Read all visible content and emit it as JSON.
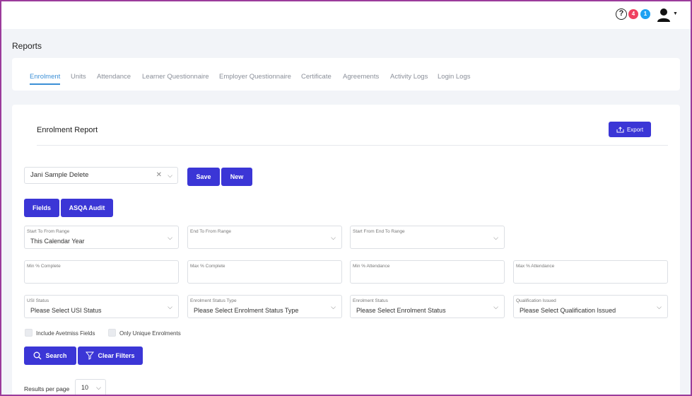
{
  "header": {
    "help_glyph": "?",
    "badges": {
      "red_count": "4",
      "blue_count": "1"
    },
    "colors": {
      "red": "#f0405f",
      "blue": "#1da1f2"
    }
  },
  "page": {
    "title": "Reports"
  },
  "tabs": [
    {
      "label": "Enrolment",
      "active": true
    },
    {
      "label": "Units"
    },
    {
      "label": "Attendance"
    },
    {
      "label": "Learner Questionnaire"
    },
    {
      "label": "Employer Questionnaire"
    },
    {
      "label": "Certificate"
    },
    {
      "label": "Agreements"
    },
    {
      "label": "Activity Logs"
    },
    {
      "label": "Login Logs"
    }
  ],
  "report": {
    "title": "Enrolment Report",
    "export_label": "Export",
    "preset": {
      "value": "Jani Sample Delete"
    },
    "save_label": "Save",
    "new_label": "New",
    "fields_label": "Fields",
    "asqa_label": "ASQA Audit"
  },
  "filters": {
    "start_to_from": {
      "label": "Start To From Range",
      "value": "This Calendar Year"
    },
    "end_to_from": {
      "label": "End To From Range",
      "value": ""
    },
    "start_from_end": {
      "label": "Start From End To Range",
      "value": ""
    },
    "min_complete": {
      "label": "Min % Complete",
      "value": ""
    },
    "max_complete": {
      "label": "Max % Complete",
      "value": ""
    },
    "min_attendance": {
      "label": "Min % Attendance",
      "value": ""
    },
    "max_attendance": {
      "label": "Max % Attendance",
      "value": ""
    },
    "usi_status": {
      "label": "USI Status",
      "value": "Please Select USI Status"
    },
    "enrolment_status_type": {
      "label": "Enrolment Status Type",
      "value": "Please Select Enrolment Status Type"
    },
    "enrolment_status": {
      "label": "Enrolment Status",
      "value": "Please Select Enrolment Status"
    },
    "qualification_issued": {
      "label": "Qualification Issued",
      "value": "Please Select Qualification Issued"
    },
    "include_avetmiss_label": "Include Avetmiss Fields",
    "only_unique_label": "Only Unique Enrolments",
    "search_label": "Search",
    "clear_label": "Clear Filters"
  },
  "pagination": {
    "results_label": "Results per page",
    "page_size": "10"
  },
  "theme": {
    "primary": "#3b36d6",
    "tab_active": "#3b8fd6"
  }
}
